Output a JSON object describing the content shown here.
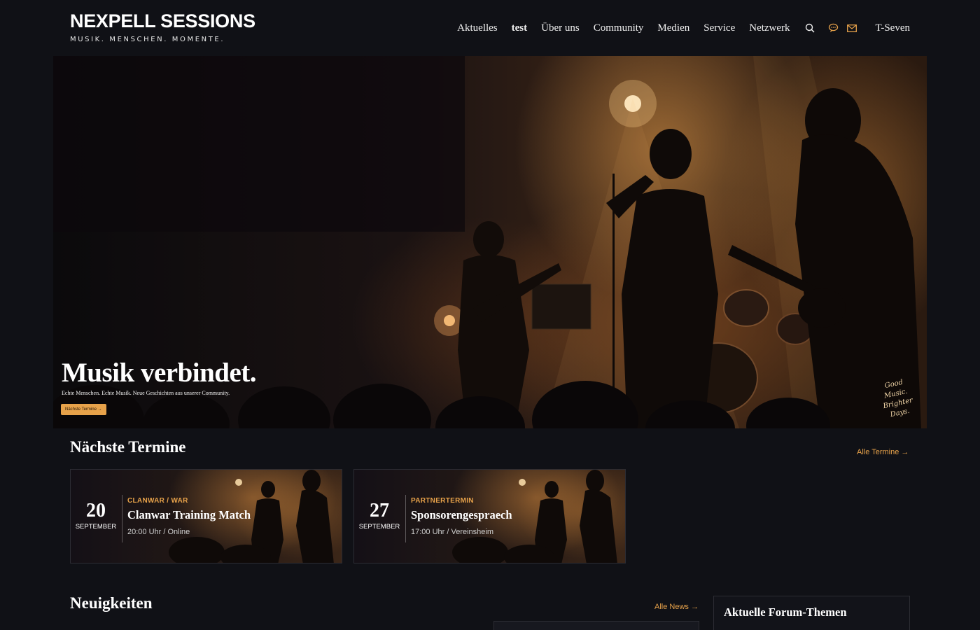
{
  "brand": {
    "title": "NEXPELL SESSIONS",
    "tagline": "MUSIK. MENSCHEN. MOMENTE."
  },
  "nav": {
    "items": [
      "Aktuelles",
      "test",
      "Über uns",
      "Community",
      "Medien",
      "Service",
      "Netzwerk"
    ],
    "user": "T-Seven",
    "icons": [
      "search-icon",
      "chat-icon",
      "mail-icon"
    ]
  },
  "hero": {
    "title": "Musik verbindet.",
    "subtitle": "Echte Menschen. Echte Musik. Neue Geschichten aus unserer Community.",
    "button": "Nächste Termine →",
    "sign": [
      "Good",
      "Music.",
      "Brighter",
      "Days."
    ]
  },
  "events": {
    "title": "Nächste Termine",
    "link": "Alle Termine →",
    "items": [
      {
        "day": "20",
        "month": "SEPTEMBER",
        "category": "CLANWAR / WAR",
        "name": "Clanwar Training Match",
        "meta": "20:00 Uhr / Online"
      },
      {
        "day": "27",
        "month": "SEPTEMBER",
        "category": "PARTNERTERMIN",
        "name": "Sponsorengespraech",
        "meta": "17:00 Uhr / Vereinsheim"
      }
    ]
  },
  "news": {
    "title": "Neuigkeiten",
    "link": "Alle News →"
  },
  "forum": {
    "title": "Aktuelle Forum-Themen"
  },
  "colors": {
    "accent": "#e7a24a",
    "background": "#101116"
  }
}
